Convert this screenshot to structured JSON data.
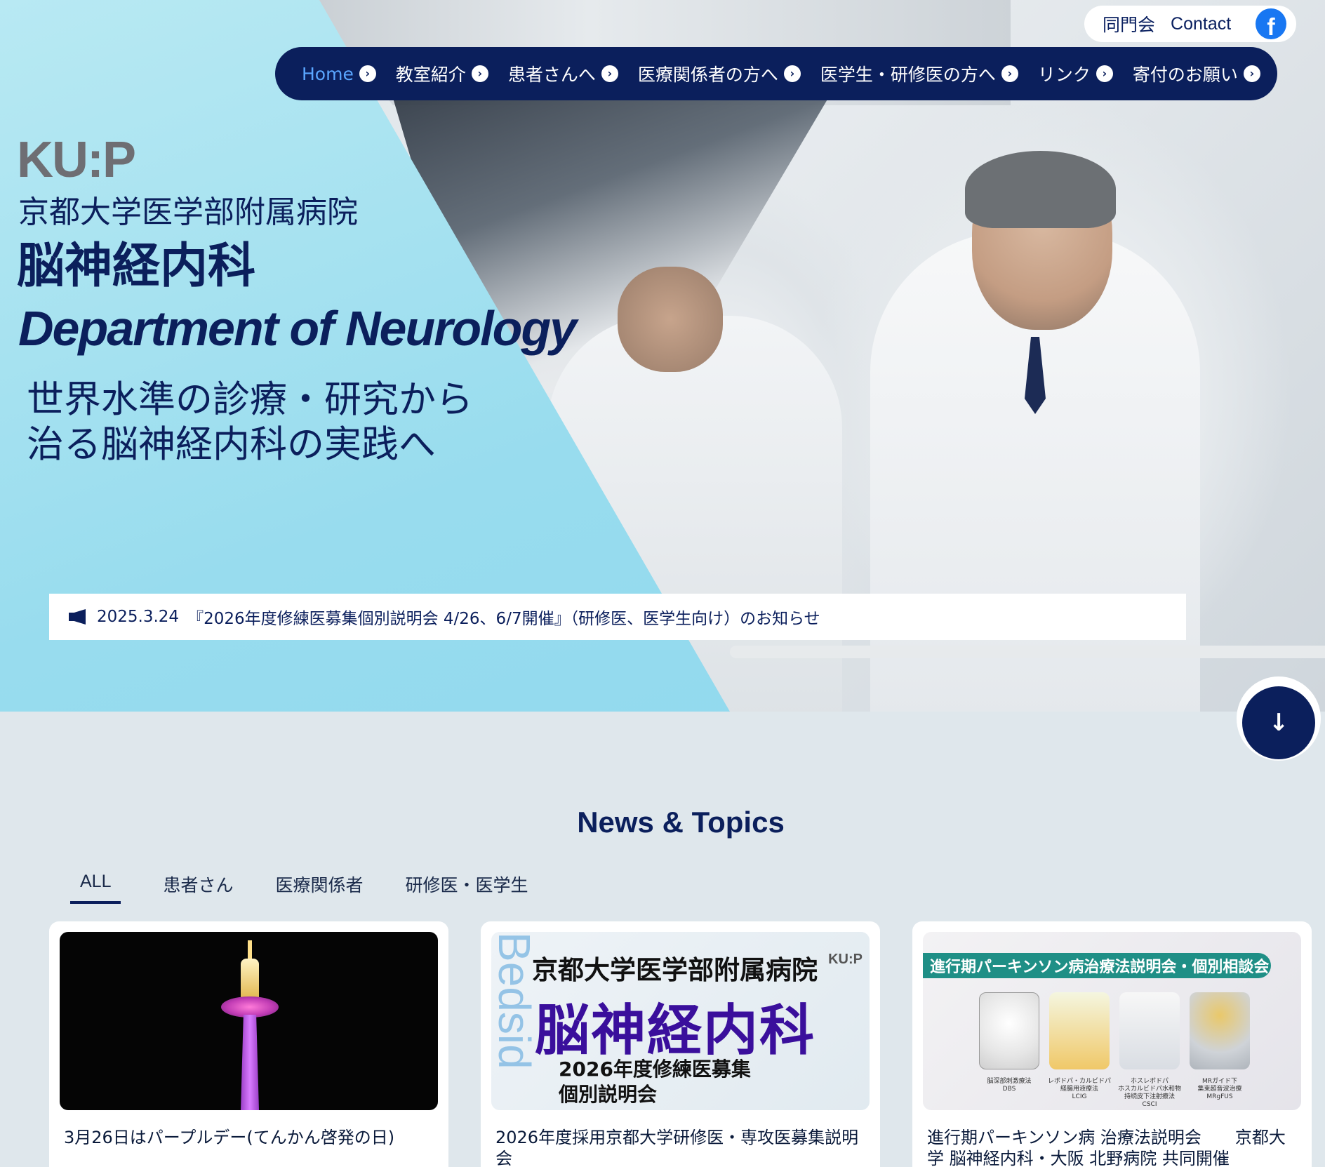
{
  "header": {
    "top_links": [
      "同門会",
      "Contact"
    ],
    "facebook_glyph": "f"
  },
  "nav": {
    "items": [
      {
        "label": "Home",
        "active": true
      },
      {
        "label": "教室紹介",
        "active": false
      },
      {
        "label": "患者さんへ",
        "active": false
      },
      {
        "label": "医療関係者の方へ",
        "active": false
      },
      {
        "label": "医学生・研修医の方へ",
        "active": false
      },
      {
        "label": "リンク",
        "active": false
      },
      {
        "label": "寄付のお願い",
        "active": false
      }
    ]
  },
  "hero": {
    "logo_text": "KU:P",
    "hospital_name": "京都大学医学部附属病院",
    "department_jp": "脳神経内科",
    "department_en": "Department of Neurology",
    "tagline_line1": "世界水準の診療・研究から",
    "tagline_line2": "治る脳神経内科の実践へ"
  },
  "announcement": {
    "date": "2025.3.24",
    "text": "『2026年度修練医募集個別説明会 4/26、6/7開催』（研修医、医学生向け）のお知らせ"
  },
  "news": {
    "title": "News & Topics",
    "tabs": [
      "ALL",
      "患者さん",
      "医療関係者",
      "研修医・医学生"
    ],
    "cards": [
      {
        "title": "3月26日はパープルデー(てんかん啓発の日)",
        "image_icon": "kyoto-tower-icon"
      },
      {
        "title": "2026年度採用京都大学研修医・専攻医募集説明会",
        "poster": {
          "side_text": "Bedsid",
          "line1": "京都大学医学部附属病院",
          "logo": "KU:P",
          "line2": "脳神経内科",
          "line3": "2026年度修練医募集",
          "line4": "個別説明会"
        }
      },
      {
        "title": "進行期パーキンソン病 治療法説明会　　京都大学 脳神経内科・大阪 北野病院 共同開催",
        "banner": "進行期パーキンソン病治療法説明会・個別相談会",
        "labels": [
          "脳深部刺激療法\nDBS",
          "レボドパ・カルビドパ\n経腸用液療法\nLCIG",
          "ホスレボドパ\nホスカルビドパ水和物\n持続皮下注射療法\nCSCI",
          "MRガイド下\n集束超音波治療\nMRgFUS"
        ]
      }
    ]
  },
  "colors": {
    "navy": "#0b1f5c",
    "accent_active": "#5aa6ff",
    "hero_cyan": "#98dcee",
    "facebook": "#1877f2"
  }
}
